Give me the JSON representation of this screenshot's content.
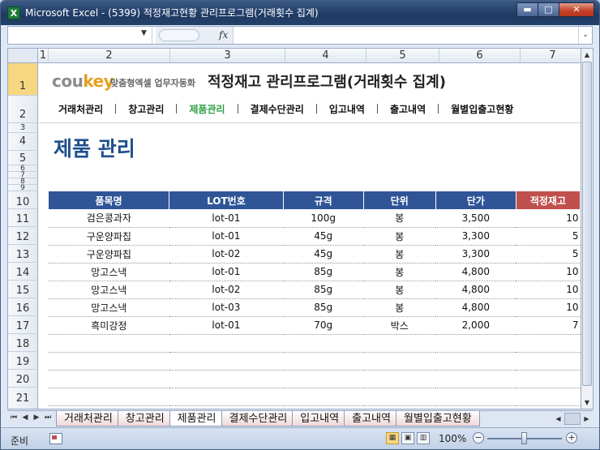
{
  "window": {
    "title": "Microsoft Excel - (5399) 적정재고현황 관리프로그램(거래횟수 집계)",
    "app_icon_letter": "X",
    "buttons": {
      "minimize": "▬",
      "maximize": "□",
      "close": "✕"
    }
  },
  "formula_bar": {
    "fx_label": "fx",
    "name_box_arrow": "▼",
    "expand_arrow": "⌄",
    "name_box_value": "",
    "formula_value": ""
  },
  "columns": [
    "1",
    "2",
    "3",
    "4",
    "5",
    "6",
    "7"
  ],
  "rows": [
    "1",
    "2",
    "3",
    "4",
    "5",
    "6",
    "7",
    "8",
    "9",
    "10",
    "11",
    "12",
    "13",
    "14",
    "15",
    "16",
    "17",
    "18",
    "19",
    "20",
    "21"
  ],
  "header": {
    "logo_prefix": "cou",
    "logo_key": "key",
    "logo_tagline": "맞춤형엑셀 업무자동화",
    "program_title": "적정재고 관리프로그램(거래횟수 집계)"
  },
  "menu": {
    "items": [
      {
        "label": "거래처관리",
        "active": false
      },
      {
        "label": "창고관리",
        "active": false
      },
      {
        "label": "제품관리",
        "active": true
      },
      {
        "label": "결제수단관리",
        "active": false
      },
      {
        "label": "입고내역",
        "active": false
      },
      {
        "label": "출고내역",
        "active": false
      },
      {
        "label": "월별입출고현황",
        "active": false
      }
    ]
  },
  "page_title": "제품 관리",
  "table": {
    "headers": [
      "품목명",
      "LOT번호",
      "규격",
      "단위",
      "단가",
      "적정재고"
    ],
    "rows": [
      [
        "검은콩과자",
        "lot-01",
        "100g",
        "봉",
        "3,500",
        "10"
      ],
      [
        "구운양파칩",
        "lot-01",
        "45g",
        "봉",
        "3,300",
        "5"
      ],
      [
        "구운양파칩",
        "lot-02",
        "45g",
        "봉",
        "3,300",
        "5"
      ],
      [
        "망고스낵",
        "lot-01",
        "85g",
        "봉",
        "4,800",
        "10"
      ],
      [
        "망고스낵",
        "lot-02",
        "85g",
        "봉",
        "4,800",
        "10"
      ],
      [
        "망고스낵",
        "lot-03",
        "85g",
        "봉",
        "4,800",
        "10"
      ],
      [
        "흑미강정",
        "lot-01",
        "70g",
        "박스",
        "2,000",
        "7"
      ]
    ]
  },
  "sheet_tabs": [
    {
      "label": "거래처관리",
      "active": false
    },
    {
      "label": "창고관리",
      "active": false
    },
    {
      "label": "제품관리",
      "active": true
    },
    {
      "label": "결제수단관리",
      "active": false
    },
    {
      "label": "입고내역",
      "active": false
    },
    {
      "label": "출고내역",
      "active": false
    },
    {
      "label": "월별입출고현황",
      "active": false
    }
  ],
  "status": {
    "ready": "준비",
    "zoom": "100%",
    "zoom_minus": "−",
    "zoom_plus": "+"
  },
  "colors": {
    "header_blue": "#2f5597",
    "header_red": "#c0504d",
    "title_blue": "#1f4e8c",
    "menu_active": "#2e9e44",
    "logo_orange": "#e4a01e"
  }
}
